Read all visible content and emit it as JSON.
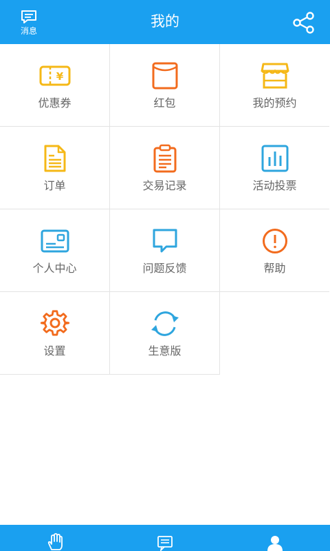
{
  "header": {
    "messages_label": "消息",
    "title": "我的"
  },
  "grid": {
    "items": [
      {
        "label": "优惠券",
        "icon": "coupon-icon"
      },
      {
        "label": "红包",
        "icon": "red-envelope-icon"
      },
      {
        "label": "我的预约",
        "icon": "store-icon"
      },
      {
        "label": "订单",
        "icon": "document-icon"
      },
      {
        "label": "交易记录",
        "icon": "clipboard-icon"
      },
      {
        "label": "活动投票",
        "icon": "bar-chart-icon"
      },
      {
        "label": "个人中心",
        "icon": "id-card-icon"
      },
      {
        "label": "问题反馈",
        "icon": "chat-bubble-icon"
      },
      {
        "label": "帮助",
        "icon": "exclamation-circle-icon"
      },
      {
        "label": "设置",
        "icon": "gear-icon"
      },
      {
        "label": "生意版",
        "icon": "refresh-icon"
      }
    ]
  },
  "bottom_nav": {
    "items": [
      {
        "icon": "hand-icon"
      },
      {
        "icon": "news-icon"
      },
      {
        "icon": "user-icon",
        "active": true
      }
    ]
  },
  "colors": {
    "brand_blue": "#1aa0f0",
    "icon_yellow": "#f5b817",
    "icon_orange": "#f26b1d",
    "icon_blue": "#2ea5de",
    "label_gray": "#666666",
    "divider": "#e3e3e3"
  }
}
